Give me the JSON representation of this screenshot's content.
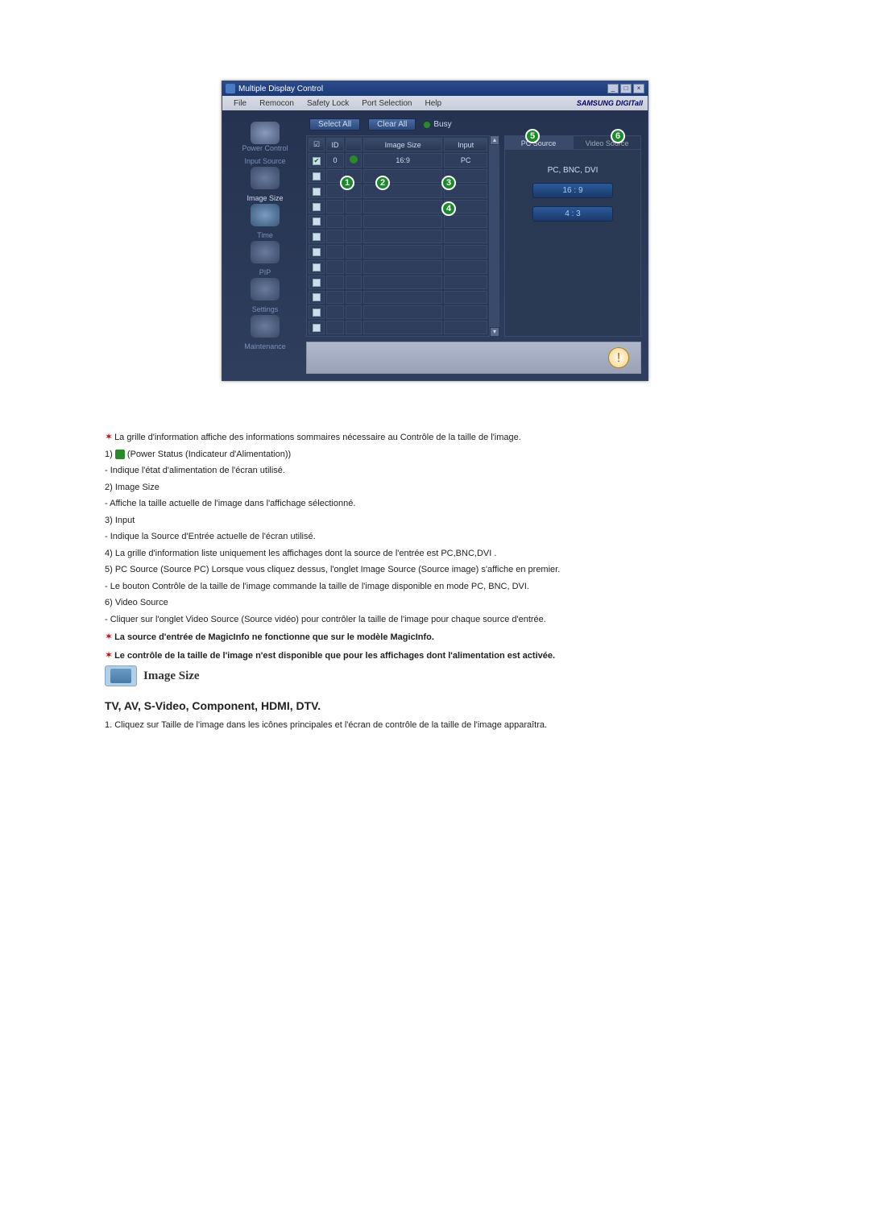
{
  "window": {
    "title": "Multiple Display Control",
    "btn_min": "_",
    "btn_max": "□",
    "btn_close": "×"
  },
  "menubar": {
    "items": [
      "File",
      "Remocon",
      "Safety Lock",
      "Port Selection",
      "Help"
    ],
    "brand": "SAMSUNG DIGITall"
  },
  "sidebar": {
    "items": [
      {
        "label": "Power Control"
      },
      {
        "label": "Input Source"
      },
      {
        "label": "Image Size"
      },
      {
        "label": "Time"
      },
      {
        "label": "PIP"
      },
      {
        "label": "Settings"
      },
      {
        "label": "Maintenance"
      }
    ]
  },
  "toolbar": {
    "select_all": "Select All",
    "clear_all": "Clear All",
    "busy": "Busy"
  },
  "grid": {
    "headers": {
      "check": "☑",
      "id": "ID",
      "power": " ",
      "image_size": "Image Size",
      "input": "Input"
    },
    "row1": {
      "id": "0",
      "image_size": "16:9",
      "input": "PC"
    }
  },
  "tabs": {
    "pc_source": "PC Source",
    "video_source": "Video Source",
    "header": "PC, BNC, DVI",
    "opt1": "16 : 9",
    "opt2": "4 : 3"
  },
  "callouts": {
    "c1": "1",
    "c2": "2",
    "c3": "3",
    "c4": "4",
    "c5": "5",
    "c6": "6"
  },
  "doc": {
    "intro": "La grille d'information affiche des informations sommaires nécessaire au Contrôle de la taille de l'image.",
    "item1a": "1)",
    "item1b": " (Power Status (Indicateur d'Alimentation))",
    "item1c": "- Indique l'état d'alimentation de l'écran utilisé.",
    "item2a": "2)  Image Size",
    "item2b": "- Affiche la taille actuelle de l'image dans l'affichage sélectionné.",
    "item3a": "3)  Input",
    "item3b": "- Indique la Source d'Entrée actuelle de l'écran utilisé.",
    "item4": "4)  La grille d'information liste uniquement les affichages dont la source de l'entrée est PC,BNC,DVI .",
    "item5a": "5)  PC Source (Source PC) Lorsque vous cliquez dessus, l'onglet Image Source (Source image) s'affiche en premier.",
    "item5b": "- Le bouton Contrôle de la taille de l'image commande la taille de l'image disponible en mode PC, BNC, DVI.",
    "item6a": "6)  Video Source",
    "item6b": "- Cliquer sur l'onglet Video Source (Source vidéo) pour contrôler la taille de l'image pour chaque source d'entrée.",
    "note1": "La source d'entrée de MagicInfo ne fonctionne que sur le modèle MagicInfo.",
    "note2": "Le contrôle de la taille de l'image n'est disponible que pour les affichages dont l'alimentation est activée.",
    "section_title": "Image Size",
    "subheading": "TV, AV, S-Video, Component, HDMI, DTV.",
    "step1": "1.  Cliquez sur Taille de l'image dans les icônes principales et l'écran de contrôle de la taille de l'image apparaîtra."
  }
}
